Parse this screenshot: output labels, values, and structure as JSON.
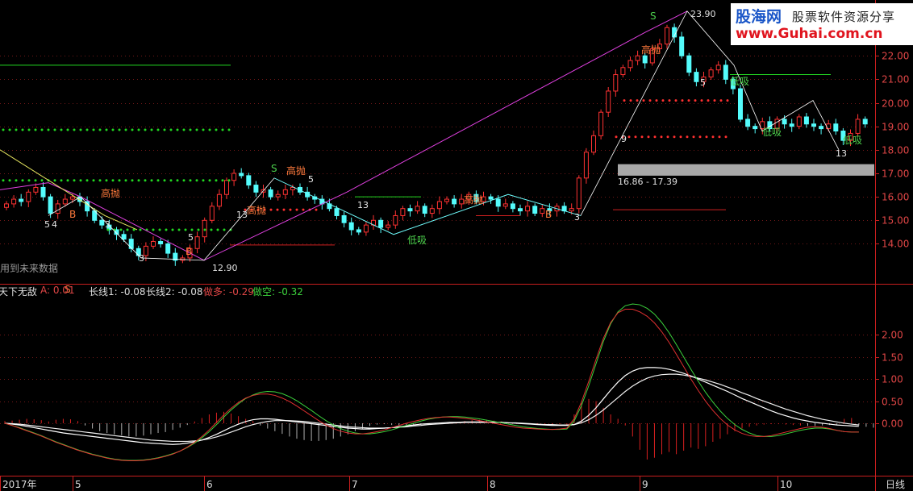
{
  "brand": {
    "logo": "股海网",
    "slogan": "股票软件资源分享",
    "url": "www.Guhai.com.cn"
  },
  "note": "用到未来数据",
  "indicator": {
    "name": "天下无敌",
    "a_text": "A: 0.01",
    "l1_text": "长线1: -0.08",
    "l2_text": "长线2: -0.08",
    "long_text": "做多: -0.29",
    "short_text": "做空: -0.32"
  },
  "period": "日线",
  "colors": {
    "up": "#ff3232",
    "down": "#54fcfc",
    "buy": "#4cd04c",
    "sell": "#ff7a3c",
    "white_line": "#ffffff",
    "green_line": "#3cd23c",
    "red_line": "#e03030",
    "magenta_line": "#e040e0",
    "yellow_line": "#e8e860",
    "axis": "#c81e1e"
  },
  "chart_data": {
    "type": "candlestick",
    "price_axis": {
      "ticks": [
        14.0,
        15.0,
        16.0,
        17.0,
        18.0,
        19.0,
        20.0,
        21.0,
        22.0
      ],
      "labels": [
        "14.00",
        "15.00",
        "16.00",
        "17.00",
        "18.00",
        "19.00",
        "20.00",
        "21.00",
        "22.00"
      ],
      "range": [
        12.3,
        24.1
      ]
    },
    "indicator_axis": {
      "ticks": [
        0.0,
        0.5,
        1.0,
        1.5,
        2.0
      ],
      "labels": [
        "0.00",
        "0.50",
        "1.00",
        "1.50",
        "2.00"
      ],
      "range": [
        -1.15,
        2.9
      ]
    },
    "x_axis": {
      "labels": [
        "2017年",
        "5",
        "6",
        "7",
        "8",
        "9",
        "10"
      ]
    },
    "price_annotations": [
      "23.90",
      "12.90",
      "16.86 - 17.39"
    ],
    "signals": [
      "高抛",
      "高抛",
      "高抛",
      "高抛",
      "高抛",
      "低吸",
      "低吸",
      "低吸",
      "低吸",
      "S",
      "S",
      "S",
      "B",
      "B",
      "B"
    ],
    "counts": [
      "5",
      "3",
      "4",
      "13",
      "5",
      "3",
      "5",
      "13",
      "9",
      "5",
      "13",
      "3"
    ],
    "closes": [
      15.7,
      15.9,
      15.8,
      16.2,
      16.4,
      16.0,
      15.3,
      15.7,
      15.9,
      16.0,
      15.8,
      15.4,
      15.0,
      14.8,
      14.6,
      14.4,
      14.2,
      13.8,
      13.5,
      13.9,
      14.1,
      14.0,
      13.6,
      13.3,
      13.4,
      13.8,
      14.3,
      15.0,
      15.6,
      16.1,
      16.7,
      17.0,
      16.9,
      16.5,
      16.2,
      16.3,
      16.0,
      16.1,
      16.3,
      16.4,
      16.2,
      16.0,
      15.9,
      15.7,
      15.5,
      15.2,
      14.9,
      14.6,
      14.5,
      14.8,
      15.0,
      14.7,
      14.8,
      15.2,
      15.5,
      15.4,
      15.6,
      15.3,
      15.5,
      15.8,
      15.9,
      15.7,
      15.9,
      16.1,
      15.8,
      16.0,
      15.9,
      15.6,
      15.7,
      15.5,
      15.4,
      15.6,
      15.3,
      15.5,
      15.4,
      15.6,
      15.4,
      15.5,
      16.8,
      17.9,
      18.6,
      19.6,
      20.5,
      21.2,
      21.5,
      21.8,
      22.0,
      21.7,
      22.3,
      22.5,
      23.2,
      22.8,
      22.0,
      21.3,
      20.9,
      21.1,
      21.4,
      21.6,
      21.0,
      20.6,
      19.3,
      19.0,
      18.9,
      19.2,
      18.9,
      19.3,
      19.1,
      19.0,
      19.4,
      19.1,
      19.0,
      18.9,
      19.1,
      18.8,
      18.4,
      18.7,
      19.3,
      19.1
    ],
    "indicator_lines": {
      "white_1": [
        0.0,
        -0.02,
        -0.04,
        -0.07,
        -0.1,
        -0.13,
        -0.16,
        -0.19,
        -0.22,
        -0.24,
        -0.26,
        -0.28,
        -0.3,
        -0.32,
        -0.34,
        -0.36,
        -0.38,
        -0.4,
        -0.42,
        -0.44,
        -0.45,
        -0.46,
        -0.47,
        -0.48,
        -0.47,
        -0.45,
        -0.42,
        -0.38,
        -0.32,
        -0.25,
        -0.17,
        -0.09,
        -0.02,
        0.04,
        0.08,
        0.1,
        0.1,
        0.09,
        0.07,
        0.05,
        0.03,
        0.01,
        -0.01,
        -0.03,
        -0.05,
        -0.07,
        -0.09,
        -0.11,
        -0.12,
        -0.13,
        -0.13,
        -0.12,
        -0.11,
        -0.1,
        -0.08,
        -0.06,
        -0.04,
        -0.02,
        -0.01,
        0.0,
        0.01,
        0.02,
        0.02,
        0.03,
        0.03,
        0.03,
        0.03,
        0.02,
        0.02,
        0.01,
        0.0,
        -0.01,
        -0.02,
        -0.03,
        -0.04,
        -0.05,
        -0.05,
        -0.05,
        -0.03,
        0.05,
        0.18,
        0.35,
        0.55,
        0.75,
        0.93,
        1.08,
        1.18,
        1.24,
        1.26,
        1.26,
        1.25,
        1.22,
        1.18,
        1.13,
        1.07,
        1.0,
        0.93,
        0.86,
        0.79,
        0.72,
        0.64,
        0.56,
        0.49,
        0.42,
        0.35,
        0.28,
        0.22,
        0.17,
        0.12,
        0.08,
        0.05,
        0.02,
        0.0,
        -0.02,
        -0.04,
        -0.05,
        -0.06,
        -0.07
      ],
      "white_2": [
        0.0,
        -0.01,
        -0.02,
        -0.04,
        -0.06,
        -0.08,
        -0.1,
        -0.12,
        -0.14,
        -0.16,
        -0.18,
        -0.2,
        -0.22,
        -0.24,
        -0.26,
        -0.28,
        -0.3,
        -0.32,
        -0.34,
        -0.36,
        -0.38,
        -0.39,
        -0.4,
        -0.41,
        -0.41,
        -0.41,
        -0.4,
        -0.38,
        -0.35,
        -0.31,
        -0.26,
        -0.2,
        -0.14,
        -0.08,
        -0.03,
        0.01,
        0.04,
        0.06,
        0.06,
        0.06,
        0.05,
        0.04,
        0.02,
        0.0,
        -0.02,
        -0.04,
        -0.06,
        -0.08,
        -0.09,
        -0.1,
        -0.11,
        -0.11,
        -0.11,
        -0.1,
        -0.09,
        -0.08,
        -0.06,
        -0.05,
        -0.03,
        -0.02,
        -0.01,
        0.0,
        0.01,
        0.02,
        0.02,
        0.02,
        0.02,
        0.02,
        0.02,
        0.01,
        0.01,
        0.0,
        -0.01,
        -0.02,
        -0.03,
        -0.03,
        -0.04,
        -0.04,
        -0.03,
        0.01,
        0.08,
        0.18,
        0.3,
        0.44,
        0.58,
        0.72,
        0.84,
        0.94,
        1.02,
        1.07,
        1.1,
        1.11,
        1.11,
        1.09,
        1.06,
        1.02,
        0.98,
        0.93,
        0.88,
        0.82,
        0.76,
        0.69,
        0.63,
        0.56,
        0.5,
        0.44,
        0.38,
        0.32,
        0.27,
        0.22,
        0.17,
        0.13,
        0.09,
        0.06,
        0.03,
        0.0,
        -0.02,
        -0.04
      ],
      "green": [
        0.0,
        -0.05,
        -0.1,
        -0.16,
        -0.22,
        -0.28,
        -0.35,
        -0.42,
        -0.48,
        -0.54,
        -0.6,
        -0.65,
        -0.7,
        -0.74,
        -0.78,
        -0.81,
        -0.83,
        -0.84,
        -0.84,
        -0.83,
        -0.81,
        -0.78,
        -0.74,
        -0.69,
        -0.63,
        -0.55,
        -0.45,
        -0.33,
        -0.19,
        -0.03,
        0.14,
        0.3,
        0.44,
        0.56,
        0.64,
        0.7,
        0.72,
        0.71,
        0.67,
        0.6,
        0.51,
        0.4,
        0.29,
        0.17,
        0.06,
        -0.04,
        -0.12,
        -0.18,
        -0.22,
        -0.24,
        -0.24,
        -0.22,
        -0.19,
        -0.15,
        -0.1,
        -0.05,
        0.0,
        0.05,
        0.09,
        0.12,
        0.14,
        0.15,
        0.15,
        0.14,
        0.12,
        0.1,
        0.07,
        0.04,
        0.01,
        -0.02,
        -0.05,
        -0.08,
        -0.1,
        -0.12,
        -0.13,
        -0.14,
        -0.14,
        -0.13,
        0.05,
        0.4,
        0.85,
        1.35,
        1.85,
        2.25,
        2.52,
        2.66,
        2.7,
        2.68,
        2.6,
        2.47,
        2.28,
        2.05,
        1.78,
        1.5,
        1.22,
        0.95,
        0.7,
        0.48,
        0.28,
        0.11,
        -0.03,
        -0.14,
        -0.22,
        -0.28,
        -0.3,
        -0.3,
        -0.28,
        -0.24,
        -0.2,
        -0.16,
        -0.13,
        -0.11,
        -0.11,
        -0.13,
        -0.16,
        -0.19,
        -0.2,
        -0.2
      ],
      "red": [
        0.0,
        -0.05,
        -0.11,
        -0.17,
        -0.23,
        -0.29,
        -0.36,
        -0.43,
        -0.49,
        -0.55,
        -0.61,
        -0.66,
        -0.71,
        -0.75,
        -0.79,
        -0.82,
        -0.84,
        -0.85,
        -0.85,
        -0.84,
        -0.82,
        -0.79,
        -0.75,
        -0.7,
        -0.63,
        -0.54,
        -0.43,
        -0.3,
        -0.15,
        0.02,
        0.19,
        0.34,
        0.47,
        0.57,
        0.63,
        0.66,
        0.66,
        0.63,
        0.57,
        0.49,
        0.39,
        0.28,
        0.17,
        0.06,
        -0.04,
        -0.12,
        -0.18,
        -0.22,
        -0.24,
        -0.24,
        -0.22,
        -0.19,
        -0.15,
        -0.1,
        -0.05,
        0.0,
        0.04,
        0.08,
        0.11,
        0.13,
        0.14,
        0.14,
        0.13,
        0.11,
        0.09,
        0.06,
        0.03,
        0.0,
        -0.03,
        -0.06,
        -0.09,
        -0.11,
        -0.12,
        -0.13,
        -0.14,
        -0.14,
        -0.13,
        -0.11,
        0.1,
        0.48,
        0.95,
        1.45,
        1.92,
        2.28,
        2.5,
        2.58,
        2.58,
        2.52,
        2.42,
        2.27,
        2.07,
        1.83,
        1.56,
        1.28,
        1.0,
        0.74,
        0.5,
        0.29,
        0.11,
        -0.04,
        -0.15,
        -0.23,
        -0.28,
        -0.3,
        -0.3,
        -0.28,
        -0.24,
        -0.2,
        -0.16,
        -0.12,
        -0.09,
        -0.08,
        -0.09,
        -0.12,
        -0.16,
        -0.19,
        -0.2,
        -0.2
      ]
    },
    "histogram": [
      0.05,
      0.06,
      0.08,
      0.1,
      0.09,
      0.07,
      0.04,
      0.08,
      0.1,
      0.09,
      0.05,
      -0.05,
      -0.12,
      -0.18,
      -0.22,
      -0.25,
      -0.27,
      -0.3,
      -0.3,
      -0.28,
      -0.25,
      -0.22,
      -0.2,
      -0.15,
      -0.1,
      -0.04,
      0.04,
      0.12,
      0.2,
      0.24,
      0.26,
      0.22,
      0.16,
      0.1,
      0.05,
      -0.05,
      -0.12,
      -0.18,
      -0.24,
      -0.3,
      -0.35,
      -0.38,
      -0.4,
      -0.4,
      -0.38,
      -0.35,
      -0.3,
      -0.25,
      -0.18,
      -0.12,
      -0.06,
      -0.03,
      -0.02,
      -0.04,
      -0.05,
      -0.06,
      -0.05,
      -0.04,
      -0.03,
      -0.02,
      -0.01,
      0.01,
      0.03,
      0.05,
      0.07,
      0.08,
      0.08,
      0.06,
      0.04,
      0.02,
      0.0,
      0.0,
      -0.01,
      -0.01,
      -0.02,
      -0.02,
      -0.02,
      -0.03,
      0.2,
      0.45,
      0.55,
      0.5,
      0.35,
      0.2,
      0.1,
      -0.05,
      -0.3,
      -0.6,
      -0.82,
      -0.78,
      -0.7,
      -0.65,
      -0.7,
      -0.62,
      -0.55,
      -0.58,
      -0.52,
      -0.42,
      -0.35,
      -0.25,
      -0.18,
      -0.12,
      -0.08,
      -0.05,
      -0.03,
      -0.02,
      -0.02,
      -0.03,
      -0.04,
      -0.05,
      -0.06,
      -0.06,
      -0.05,
      -0.04,
      -0.03,
      0.1,
      0.12,
      -0.05,
      -0.08,
      -0.1
    ]
  }
}
